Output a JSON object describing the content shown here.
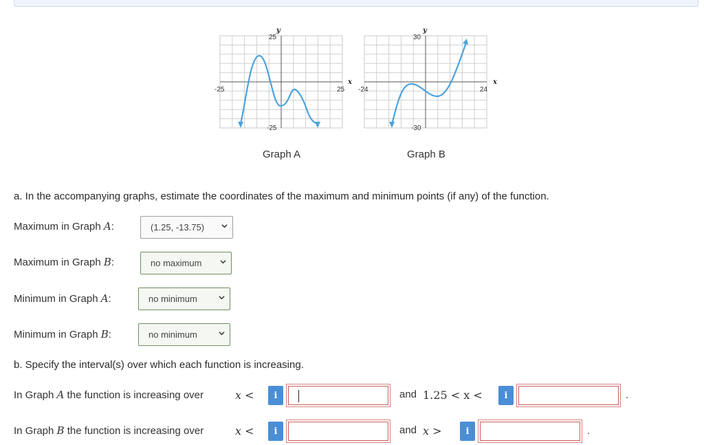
{
  "graph_a": {
    "caption": "Graph A",
    "y_axis_label": "y",
    "x_axis_label": "x",
    "y_top_tick": "25",
    "y_bottom_tick": "-25",
    "x_left_tick": "-25",
    "x_right_tick": "25",
    "curve_color": "#4aa3df"
  },
  "graph_b": {
    "caption": "Graph B",
    "y_axis_label": "y",
    "x_axis_label": "x",
    "y_top_tick": "30",
    "y_bottom_tick": "-30",
    "x_left_tick": "-24",
    "x_right_tick": "24",
    "curve_color": "#4aa3df"
  },
  "part_a": {
    "question": "a. In the accompanying graphs, estimate the coordinates of the maximum and minimum points (if any) of the function.",
    "rows": [
      {
        "label_prefix": "Maximum in Graph ",
        "var": "A",
        "label_suffix": ":",
        "selected": "(1.25, -13.75)"
      },
      {
        "label_prefix": "Maximum in Graph ",
        "var": "B",
        "label_suffix": ":",
        "selected": "no maximum"
      },
      {
        "label_prefix": "Minimum in Graph ",
        "var": "A",
        "label_suffix": ":",
        "selected": "no minimum"
      },
      {
        "label_prefix": "Minimum in Graph ",
        "var": "B",
        "label_suffix": ":",
        "selected": "no minimum"
      }
    ]
  },
  "part_b": {
    "question": "b. Specify the interval(s) over which each function is increasing.",
    "graph_a_row": {
      "label_prefix": "In Graph ",
      "var": "A",
      "label_suffix": " the function is increasing over",
      "math_left": "x <",
      "connector_text": "and",
      "connector_math": "1.25 < x <",
      "end": "."
    },
    "graph_b_row": {
      "label_prefix": "In Graph ",
      "var": "B",
      "label_suffix": " the function is increasing over",
      "math_left": "x <",
      "connector_text": "and",
      "connector_math": "x >",
      "end": "."
    },
    "info_glyph": "i"
  }
}
